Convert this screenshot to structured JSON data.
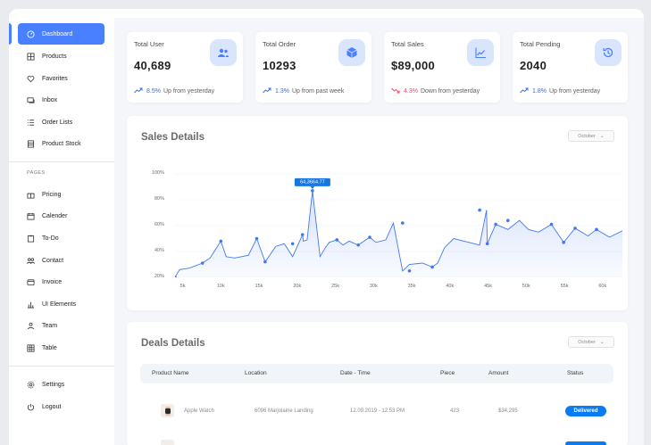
{
  "sidebar": {
    "items": [
      {
        "label": "Dashboard",
        "icon": "gauge-icon",
        "active": true
      },
      {
        "label": "Products",
        "icon": "grid-icon"
      },
      {
        "label": "Favorites",
        "icon": "heart-icon"
      },
      {
        "label": "Inbox",
        "icon": "inbox-icon"
      },
      {
        "label": "Order Lists",
        "icon": "list-icon"
      },
      {
        "label": "Product Stock",
        "icon": "stock-icon"
      }
    ],
    "section_label": "PAGES",
    "pages": [
      {
        "label": "Pricing",
        "icon": "gift-icon"
      },
      {
        "label": "Calender",
        "icon": "calendar-icon"
      },
      {
        "label": "To-Do",
        "icon": "clipboard-icon"
      },
      {
        "label": "Contact",
        "icon": "people-icon"
      },
      {
        "label": "Invoice",
        "icon": "invoice-icon"
      },
      {
        "label": "UI Elements",
        "icon": "bar-chart-icon"
      },
      {
        "label": "Team",
        "icon": "team-icon"
      },
      {
        "label": "Table",
        "icon": "table-icon"
      }
    ],
    "footer": [
      {
        "label": "Settings",
        "icon": "gear-icon"
      },
      {
        "label": "Logout",
        "icon": "power-icon"
      }
    ]
  },
  "stats": [
    {
      "title": "Total User",
      "value": "40,689",
      "pct": "8.5%",
      "text": "Up from yesterday",
      "direction": "up",
      "icon": "users-icon"
    },
    {
      "title": "Total Order",
      "value": "10293",
      "pct": "1.3%",
      "text": "Up from past week",
      "direction": "up",
      "icon": "box-icon"
    },
    {
      "title": "Total Sales",
      "value": "$89,000",
      "pct": "4.3%",
      "text": "Down from yesterday",
      "direction": "down",
      "icon": "line-chart-icon"
    },
    {
      "title": "Total Pending",
      "value": "2040",
      "pct": "1.8%",
      "text": "Up from yesterday",
      "direction": "up",
      "icon": "clock-icon"
    }
  ],
  "colors": {
    "accent": "#4880ff",
    "badge": "#0a7cf3",
    "up": "#2f6fe6",
    "down": "#f93c65",
    "line": "#4379ee"
  },
  "sales": {
    "title": "Sales Details",
    "month": "October",
    "tooltip": "64,3664.77"
  },
  "chart_data": {
    "type": "area",
    "title": "Sales Details",
    "ylim": [
      20,
      100
    ],
    "yticks": [
      "100%",
      "80%",
      "60%",
      "40%",
      "20%"
    ],
    "xticks": [
      "5k",
      "10k",
      "15k",
      "20k",
      "25k",
      "30k",
      "35k",
      "40k",
      "45k",
      "50k",
      "55k",
      "60k"
    ],
    "xlim": [
      4000,
      62600
    ],
    "x": [
      4000,
      4600,
      5800,
      7600,
      8600,
      10000,
      10700,
      11800,
      13600,
      14700,
      15800,
      17200,
      18300,
      19400,
      20700,
      20800,
      21300,
      22000,
      23000,
      23700,
      24200,
      25200,
      26000,
      26800,
      28000,
      29500,
      30300,
      31600,
      32600,
      33800,
      34700,
      36400,
      37700,
      38400,
      39300,
      40500,
      43200,
      43900,
      44800,
      44900,
      46000,
      47600,
      49100,
      50300,
      51600,
      53300,
      54900,
      56400,
      58100,
      59200,
      60900,
      62600
    ],
    "y": [
      20,
      26,
      27,
      31,
      35,
      48,
      36,
      35,
      37,
      50,
      32,
      44,
      46,
      36,
      53,
      48,
      49,
      87,
      36,
      43,
      47,
      49,
      45,
      48,
      45,
      51,
      47,
      49,
      62,
      25,
      30,
      31,
      28,
      31,
      43,
      50,
      46,
      45,
      72,
      46,
      61,
      57,
      64,
      57,
      55,
      61,
      47,
      58,
      52,
      57,
      51,
      56
    ],
    "markers_y": [
      20,
      31,
      48,
      50,
      32,
      46,
      53,
      87,
      49,
      45,
      51,
      62,
      25,
      28,
      72,
      46,
      61,
      64,
      61,
      58,
      57,
      47
    ],
    "markers_x": [
      4000,
      7600,
      10000,
      14700,
      15800,
      19400,
      20700,
      22000,
      25200,
      28000,
      29500,
      33800,
      34700,
      37700,
      43900,
      44900,
      46000,
      47600,
      53300,
      56400,
      59200,
      54900
    ],
    "grid": true
  },
  "deals": {
    "title": "Deals Details",
    "month": "October",
    "columns": [
      "Product Name",
      "Location",
      "Date - Time",
      "Piece",
      "Amount",
      "Status"
    ],
    "rows": [
      {
        "product": "Apple Watch",
        "location": "6096 Marjolaine Landing",
        "datetime": "12.09.2019 - 12.53 PM",
        "piece": "423",
        "amount": "$34,295",
        "status": "Delivered"
      }
    ]
  }
}
